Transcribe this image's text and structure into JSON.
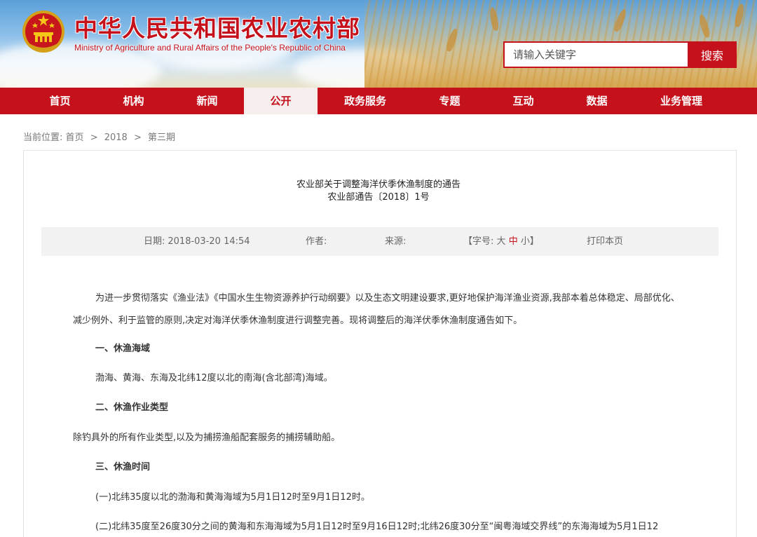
{
  "header": {
    "title_cn": "中华人民共和国农业农村部",
    "title_en": "Ministry of Agriculture and Rural Affairs of the People's Republic of China",
    "search_placeholder": "请输入关键字",
    "search_button": "搜索",
    "logo_icon": "national-emblem-icon"
  },
  "nav": {
    "items": [
      {
        "label": "首页"
      },
      {
        "label": "机构"
      },
      {
        "label": "新闻"
      },
      {
        "label": "公开"
      },
      {
        "label": "政务服务"
      },
      {
        "label": "专题"
      },
      {
        "label": "互动"
      },
      {
        "label": "数据"
      },
      {
        "label": "业务管理"
      }
    ],
    "active_index": 3
  },
  "breadcrumb": {
    "prefix": "当前位置:",
    "items": [
      "首页",
      "2018",
      "第三期"
    ],
    "separator": ">"
  },
  "article": {
    "title": "农业部关于调整海洋伏季休渔制度的通告",
    "doc_number": "农业部通告〔2018〕1号",
    "meta": {
      "date_label": "日期:",
      "date_value": "2018-03-20 14:54",
      "author_label": "作者:",
      "source_label": "来源:",
      "font_label_open": "【字号:",
      "font_large": "大",
      "font_medium": "中",
      "font_small": "小",
      "font_label_close": "】",
      "print": "打印本页"
    },
    "paragraphs": {
      "intro": "为进一步贯彻落实《渔业法》《中国水生生物资源养护行动纲要》以及生态文明建设要求,更好地保护海洋渔业资源,我部本着总体稳定、局部优化、减少例外、利于监管的原则,决定对海洋伏季休渔制度进行调整完善。现将调整后的海洋伏季休渔制度通告如下。",
      "h1": "一、休渔海域",
      "p1": "渤海、黄海、东海及北纬12度以北的南海(含北部湾)海域。",
      "h2": "二、休渔作业类型",
      "p2": "除钓具外的所有作业类型,以及为捕捞渔船配套服务的捕捞辅助船。",
      "h3": "三、休渔时间",
      "p3": "(一)北纬35度以北的渤海和黄海海域为5月1日12时至9月1日12时。",
      "p4": "(二)北纬35度至26度30分之间的黄海和东海海域为5月1日12时至9月16日12时;北纬26度30分至“闽粤海域交界线”的东海海域为5月1日12"
    }
  },
  "colors": {
    "brand_red": "#c4111b",
    "meta_bg": "#f2f2f2",
    "active_tab_bg": "#f6eded"
  }
}
